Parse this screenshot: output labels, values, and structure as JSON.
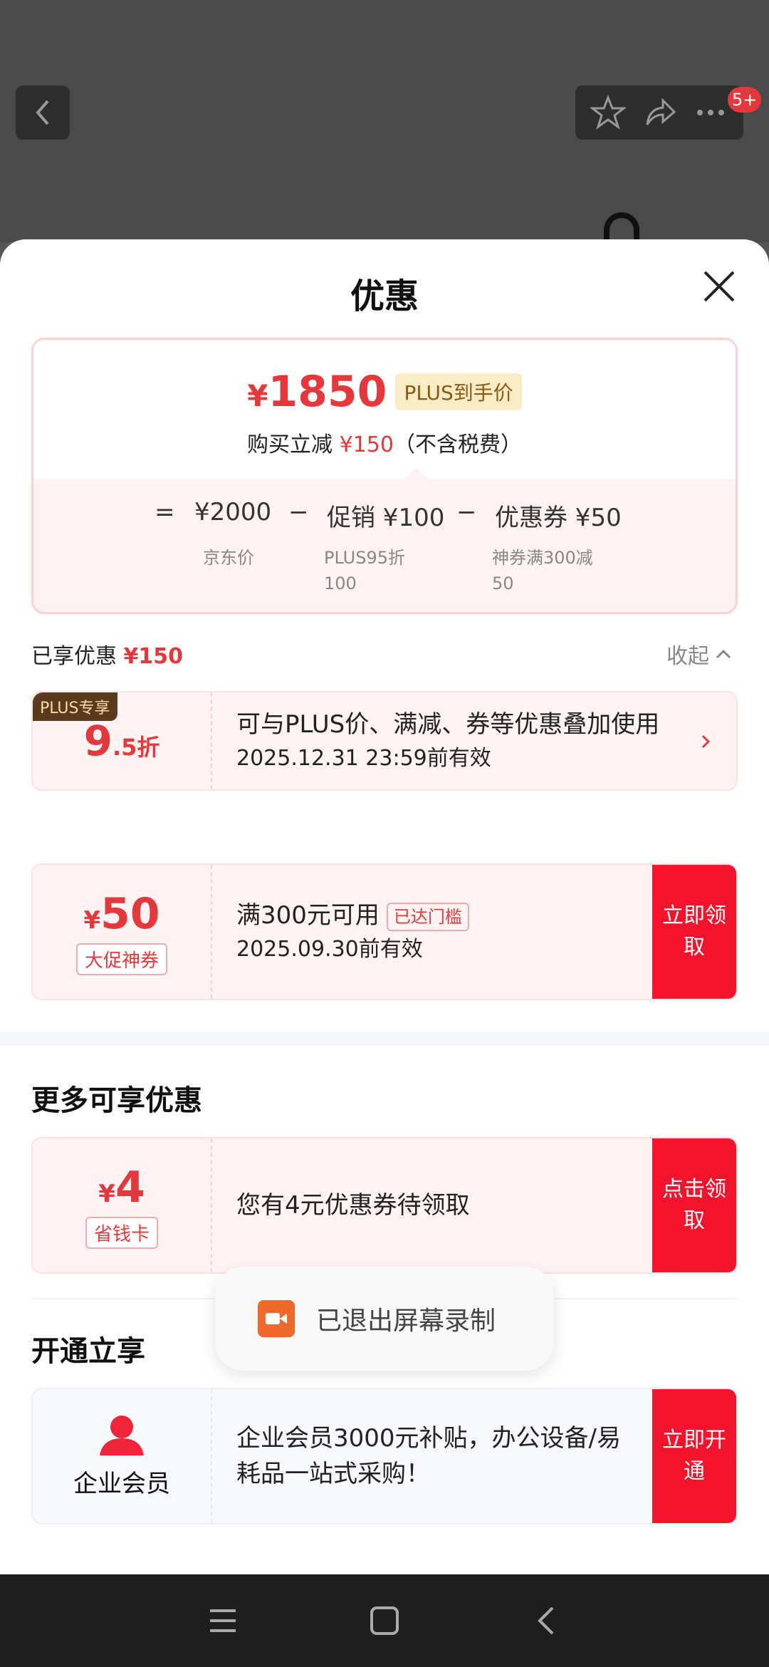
{
  "header_overlay": {
    "badge": "5+"
  },
  "sheet": {
    "title": "优惠",
    "summary": {
      "price": "1850",
      "currency": "¥",
      "plus_tag": "PLUS到手价",
      "reduce_prefix": "购买立减",
      "reduce_amount": "¥150",
      "reduce_suffix": "（不含税费）",
      "formula": {
        "eq": "=",
        "jd_price": "¥2000",
        "minus": "−",
        "promo": "促销 ¥100",
        "coupon": "优惠券 ¥50",
        "jd_price_label": "京东价",
        "promo_label_1": "PLUS95折",
        "promo_label_2": "100",
        "coupon_label_1": "神券满300减",
        "coupon_label_2": "50"
      }
    },
    "enjoyed": {
      "label": "已享优惠",
      "amount": "¥150",
      "collapse": "收起"
    },
    "plus_card": {
      "corner": "PLUS专享",
      "discount_big": "9",
      "discount_small": ".5折",
      "desc": "可与PLUS价、满减、券等优惠叠加使用",
      "validity": "2025.12.31 23:59前有效"
    },
    "coupon_card": {
      "currency": "¥",
      "amount": "50",
      "tag": "大促神券",
      "desc": "满300元可用",
      "reach_tag": "已达门槛",
      "validity": "2025.09.30前有效",
      "action": "立即领取"
    },
    "more_section": {
      "title": "更多可享优惠"
    },
    "saver_card": {
      "currency": "¥",
      "amount": "4",
      "tag": "省钱卡",
      "desc": "您有4元优惠券待领取",
      "action": "点击领取"
    },
    "open_section": {
      "title": "开通立享"
    },
    "biz_card": {
      "label": "企业会员",
      "desc": " 企业会员3000元补贴，办公设备/易耗品一站式采购！",
      "action": "立即开通"
    }
  },
  "toast": {
    "text": "已退出屏幕录制"
  },
  "colors": {
    "accent": "#e4393c",
    "action_red": "#f2142c",
    "plus_gold": "#fbecc8"
  }
}
